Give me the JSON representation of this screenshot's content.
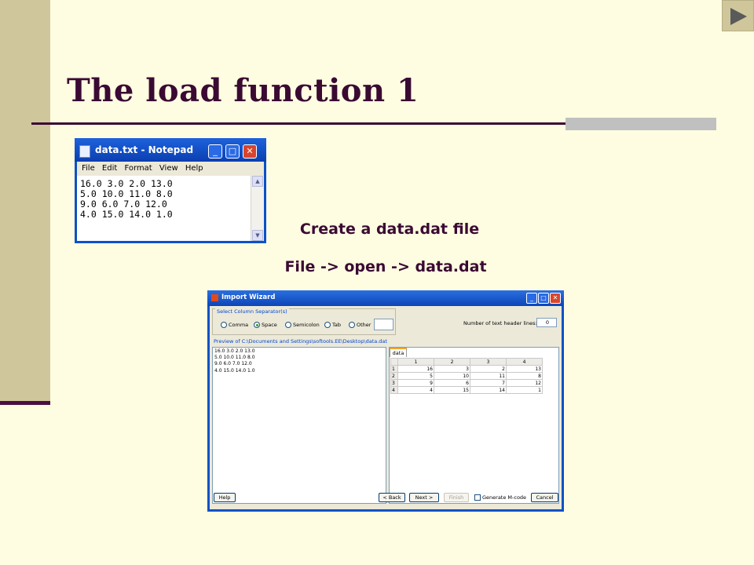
{
  "slide": {
    "title": "The load function 1",
    "caption_1": "Create a data.dat file",
    "caption_2": "File -> open -> data.dat"
  },
  "colors": {
    "background": "#fffde1",
    "sidebar": "#cfc79b",
    "title": "#3a0a33",
    "xp_title_bar": "#0b3fb0"
  },
  "notepad": {
    "title": "data.txt - Notepad",
    "menu": [
      "File",
      "Edit",
      "Format",
      "View",
      "Help"
    ],
    "content": "16.0 3.0 2.0 13.0\n5.0 10.0 11.0 8.0\n9.0 6.0 7.0 12.0\n4.0 15.0 14.0 1.0"
  },
  "wizard": {
    "title": "Import Wizard",
    "separator_group": "Select Column Separator(s)",
    "separators": [
      {
        "label": "Comma",
        "selected": false
      },
      {
        "label": "Space",
        "selected": true
      },
      {
        "label": "Semicolon",
        "selected": false
      },
      {
        "label": "Tab",
        "selected": false
      },
      {
        "label": "Other",
        "selected": false
      }
    ],
    "header_lines_label": "Number of text header lines:",
    "header_lines_value": "0",
    "preview_label": "Preview of C:\\Documents and Settings\\softools.EE\\Desktop\\data.dat",
    "preview_text": "16.0 3.0 2.0 13.0\n5.0 10.0 11.0 8.0\n9.0 6.0 7.0 12.0\n4.0 15.0 14.0 1.0",
    "tab_label": "data",
    "columns": [
      "1",
      "2",
      "3",
      "4"
    ],
    "rows": [
      {
        "label": "1",
        "cells": [
          "16",
          "3",
          "2",
          "13"
        ]
      },
      {
        "label": "2",
        "cells": [
          "5",
          "10",
          "11",
          "8"
        ]
      },
      {
        "label": "3",
        "cells": [
          "9",
          "6",
          "7",
          "12"
        ]
      },
      {
        "label": "4",
        "cells": [
          "4",
          "15",
          "14",
          "1"
        ]
      }
    ],
    "buttons": {
      "help": "Help",
      "back": "< Back",
      "next": "Next >",
      "finish": "Finish",
      "generate": "Generate M-code",
      "cancel": "Cancel"
    }
  }
}
